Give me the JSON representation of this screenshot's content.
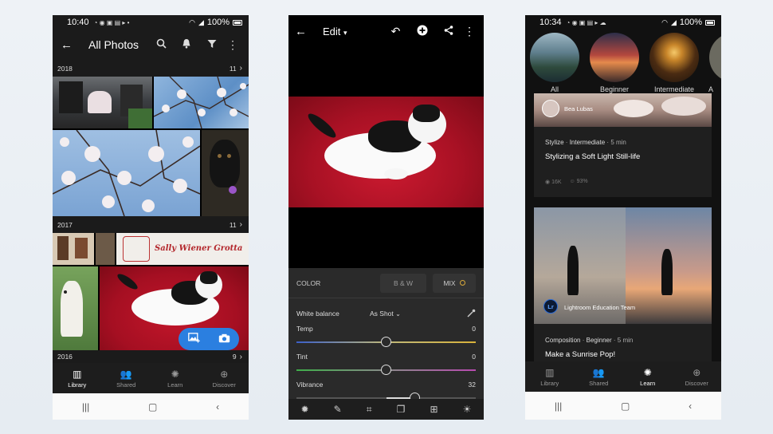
{
  "phone1": {
    "status": {
      "time": "10:40",
      "battery": "100%"
    },
    "appbar": {
      "title": "All Photos"
    },
    "sections": [
      {
        "year": "2018",
        "count": "11"
      },
      {
        "year": "2017",
        "count": "11"
      },
      {
        "year": "2016",
        "count": "9"
      }
    ],
    "sign_text": "Sally Wiener Grotta",
    "bottom_nav": [
      {
        "label": "Library",
        "icon": "library-icon"
      },
      {
        "label": "Shared",
        "icon": "people-icon"
      },
      {
        "label": "Learn",
        "icon": "bulb-icon"
      },
      {
        "label": "Discover",
        "icon": "globe-icon"
      }
    ]
  },
  "phone2": {
    "header": {
      "title": "Edit"
    },
    "color_panel": {
      "label": "COLOR",
      "bw": "B & W",
      "mix": "MIX"
    },
    "white_balance": {
      "label": "White balance",
      "value": "As Shot"
    },
    "sliders": [
      {
        "label": "Temp",
        "value": "0",
        "pos": 0.5
      },
      {
        "label": "Tint",
        "value": "0",
        "pos": 0.5
      },
      {
        "label": "Vibrance",
        "value": "32",
        "pos": 0.66
      }
    ]
  },
  "phone3": {
    "status": {
      "time": "10:34",
      "battery": "100%"
    },
    "categories": [
      {
        "label": "All"
      },
      {
        "label": "Beginner"
      },
      {
        "label": "Intermediate"
      },
      {
        "label": "A"
      }
    ],
    "card1": {
      "author": "Bea Lubas",
      "category": "Stylize",
      "level": "Intermediate",
      "duration": "5 min",
      "title": "Stylizing a Soft Light Still-life",
      "views": "16K",
      "rating": "93%"
    },
    "card2": {
      "author": "Lightroom Education Team",
      "avatar": "Lr",
      "category": "Composition",
      "level": "Beginner",
      "duration": "5 min",
      "title": "Make a Sunrise Pop!"
    },
    "bottom_nav": [
      {
        "label": "Library"
      },
      {
        "label": "Shared"
      },
      {
        "label": "Learn"
      },
      {
        "label": "Discover"
      }
    ]
  }
}
